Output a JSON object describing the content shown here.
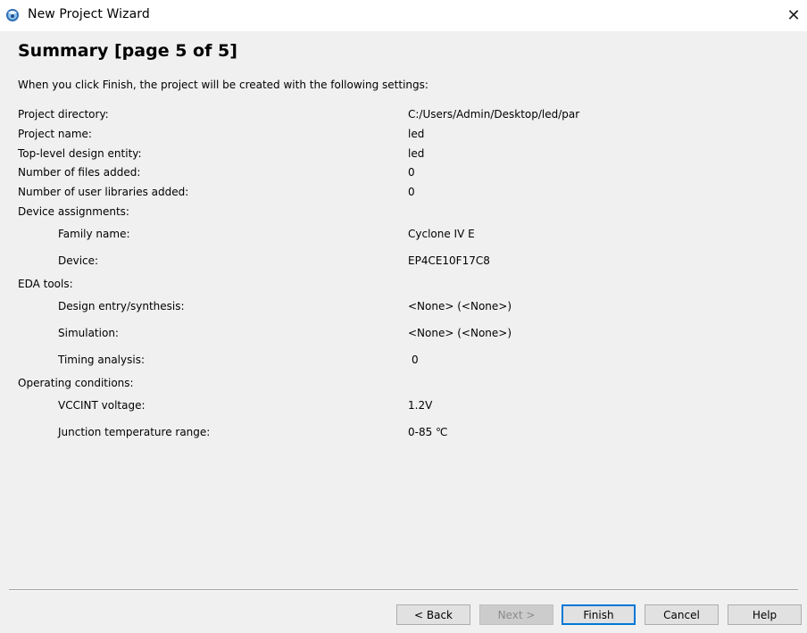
{
  "window": {
    "title": "New Project Wizard",
    "close_glyph": "✕"
  },
  "page": {
    "heading": "Summary [page 5 of 5]",
    "intro": "When you click Finish, the project will be created with the following settings:"
  },
  "settings": [
    {
      "label": "Project directory:",
      "value": "C:/Users/Admin/Desktop/led/par"
    },
    {
      "label": "Project name:",
      "value": "led"
    },
    {
      "label": "Top-level design entity:",
      "value": "led"
    },
    {
      "label": "Number of files added:",
      "value": "0"
    },
    {
      "label": "Number of user libraries added:",
      "value": "0"
    },
    {
      "label": "Device assignments:",
      "value": ""
    },
    {
      "label": "Family name:",
      "value": "Cyclone IV E"
    },
    {
      "label": "Device:",
      "value": "EP4CE10F17C8"
    },
    {
      "label": "EDA tools:",
      "value": ""
    },
    {
      "label": "Design entry/synthesis:",
      "value": "<None> (<None>)"
    },
    {
      "label": "Simulation:",
      "value": "<None> (<None>)"
    },
    {
      "label": "Timing analysis:",
      "value": "0"
    },
    {
      "label": "Operating conditions:",
      "value": ""
    },
    {
      "label": "VCCINT voltage:",
      "value": "1.2V"
    },
    {
      "label": "Junction temperature range:",
      "value": "0-85 ℃"
    }
  ],
  "buttons": {
    "back": "< Back",
    "next": "Next >",
    "finish": "Finish",
    "cancel": "Cancel",
    "help": "Help"
  },
  "colors": {
    "accent": "#0078d7",
    "icon_blue": "#2f6fb5"
  }
}
